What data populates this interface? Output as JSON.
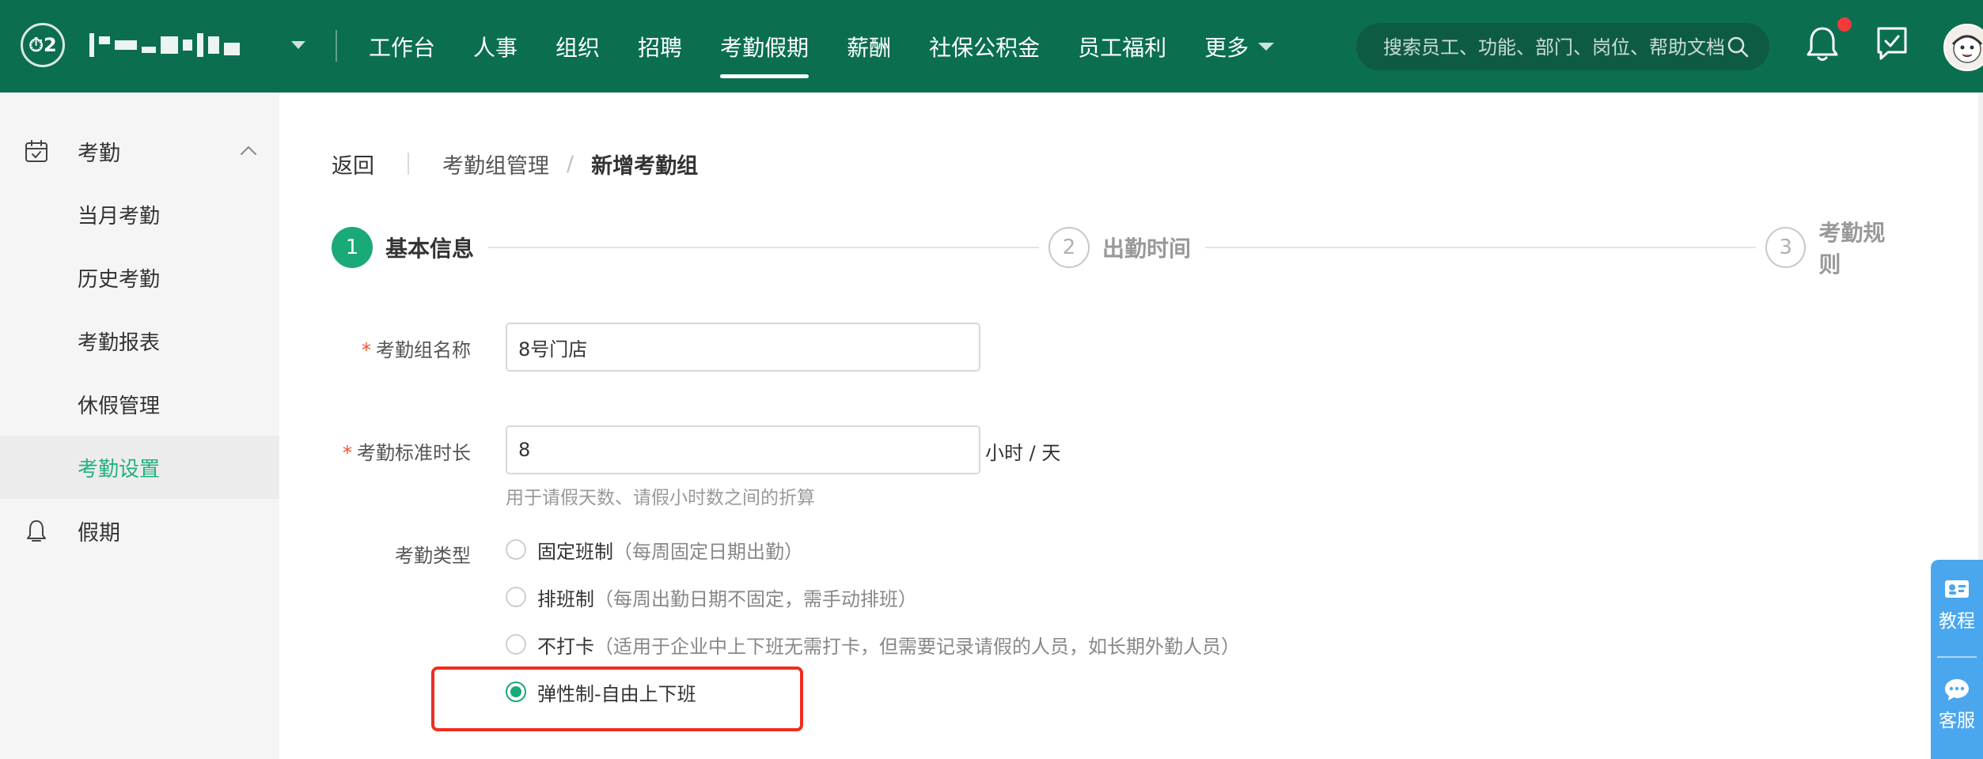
{
  "colors": {
    "topbar": "#0b6e50",
    "accent": "#1aaa77",
    "sidebar_bg": "#f5f5f5",
    "highlight": "#ee2e1f",
    "float_panel": "#4aa7ee"
  },
  "header": {
    "logo_text": "⏱2",
    "nav": [
      {
        "label": "工作台",
        "active": false
      },
      {
        "label": "人事",
        "active": false
      },
      {
        "label": "组织",
        "active": false
      },
      {
        "label": "招聘",
        "active": false
      },
      {
        "label": "考勤假期",
        "active": true
      },
      {
        "label": "薪酬",
        "active": false
      },
      {
        "label": "社保公积金",
        "active": false
      },
      {
        "label": "员工福利",
        "active": false
      },
      {
        "label": "更多",
        "active": false
      }
    ],
    "search_placeholder": "搜索员工、功能、部门、岗位、帮助文档",
    "icons": [
      "search-icon",
      "bell-icon",
      "feedback-icon",
      "avatar"
    ]
  },
  "sidebar": {
    "group_attendance": "考勤",
    "items": [
      {
        "label": "当月考勤",
        "active": false
      },
      {
        "label": "历史考勤",
        "active": false
      },
      {
        "label": "考勤报表",
        "active": false
      },
      {
        "label": "休假管理",
        "active": false
      },
      {
        "label": "考勤设置",
        "active": true
      }
    ],
    "group_holiday": "假期"
  },
  "breadcrumb": {
    "back": "返回",
    "parent": "考勤组管理",
    "separator": "/",
    "current": "新增考勤组"
  },
  "steps": [
    {
      "number": "1",
      "label": "基本信息",
      "status": "done"
    },
    {
      "number": "2",
      "label": "出勤时间",
      "status": "todo"
    },
    {
      "number": "3",
      "label": "考勤规则",
      "status": "todo"
    }
  ],
  "form": {
    "required_mark": "*",
    "group_name": {
      "label": "考勤组名称",
      "value": "8号门店"
    },
    "standard_hours": {
      "label": "考勤标准时长",
      "value": "8",
      "unit": "小时 / 天",
      "hint": "用于请假天数、请假小时数之间的折算"
    },
    "attendance_type": {
      "label": "考勤类型",
      "options": [
        {
          "label": "固定班制",
          "desc": "（每周固定日期出勤）",
          "checked": false
        },
        {
          "label": "排班制",
          "desc": "（每周出勤日期不固定，需手动排班）",
          "checked": false
        },
        {
          "label": "不打卡",
          "desc": "（适用于企业中上下班无需打卡，但需要记录请假的人员，如长期外勤人员）",
          "checked": false
        },
        {
          "label": "弹性制-自由上下班",
          "desc": "",
          "checked": true
        }
      ]
    }
  },
  "float_panel": {
    "tutorial": "教程",
    "support": "客服"
  }
}
